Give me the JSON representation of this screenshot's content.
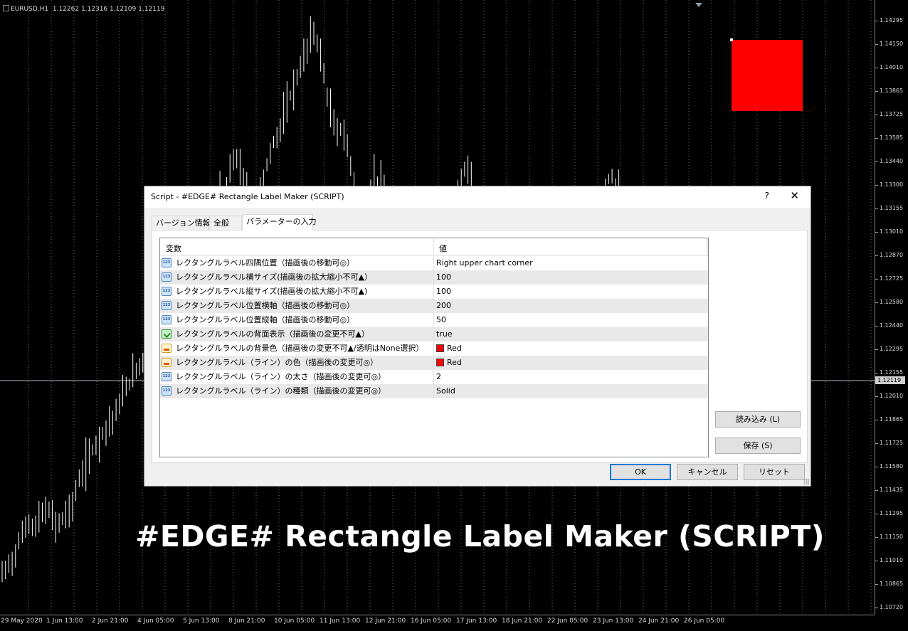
{
  "chart": {
    "symbol": "EURUSD,H1",
    "ohlc": "1.12262 1.12316 1.12109 1.12119",
    "current_price": "1.12119",
    "price_ticks": [
      "1.14295",
      "1.14150",
      "1.14010",
      "1.13865",
      "1.13725",
      "1.13585",
      "1.13440",
      "1.13300",
      "1.13155",
      "1.13010",
      "1.12870",
      "1.12725",
      "1.12580",
      "1.12440",
      "1.12295",
      "1.12155",
      "1.12010",
      "1.11865",
      "1.11725",
      "1.11580",
      "1.11435",
      "1.11295",
      "1.11150",
      "1.11010",
      "1.10865",
      "1.10720"
    ],
    "time_ticks": [
      "29 May 2020",
      "1 Jun 13:00",
      "2 Jun 21:00",
      "4 Jun 05:00",
      "5 Jun 13:00",
      "8 Jun 21:00",
      "10 Jun 05:00",
      "11 Jun 13:00",
      "12 Jun 21:00",
      "16 Jun 05:00",
      "17 Jun 13:00",
      "18 Jun 21:00",
      "22 Jun 05:00",
      "23 Jun 13:00",
      "24 Jun 21:00",
      "26 Jun 05:00"
    ],
    "price_range": [
      1.1072,
      1.1429
    ],
    "rectangle_color": "#ff0000",
    "price_series": [
      1.1094,
      1.1099,
      1.1103,
      1.1112,
      1.1121,
      1.1126,
      1.1121,
      1.1129,
      1.1133,
      1.1131,
      1.1124,
      1.1127,
      1.1131,
      1.1136,
      1.1148,
      1.1156,
      1.1164,
      1.1171,
      1.1176,
      1.1182,
      1.1186,
      1.1191,
      1.1199,
      1.1207,
      1.1212,
      1.1219,
      1.1223,
      1.1229,
      1.1236,
      1.1247,
      1.1252,
      1.1247,
      1.124,
      1.1228,
      1.1222,
      1.1236,
      1.1252,
      1.1268,
      1.1288,
      1.1312,
      1.1328,
      1.132,
      1.1332,
      1.1348,
      1.1341,
      1.1331,
      1.1322,
      1.1318,
      1.1326,
      1.1339,
      1.1352,
      1.136,
      1.1367,
      1.1379,
      1.1388,
      1.1397,
      1.1406,
      1.1418,
      1.1422,
      1.141,
      1.139,
      1.1373,
      1.136,
      1.1365,
      1.1352,
      1.1338,
      1.1321,
      1.1313,
      1.1325,
      1.1335,
      1.1331,
      1.1323,
      1.1313,
      1.13,
      1.1282,
      1.1266,
      1.125,
      1.1238,
      1.1252,
      1.1262,
      1.127,
      1.1272,
      1.1282,
      1.1301,
      1.1318,
      1.133,
      1.134,
      1.133,
      1.1312,
      1.13,
      1.1288,
      1.1278,
      1.1268,
      1.1254,
      1.124,
      1.1228,
      1.122,
      1.1212,
      1.1205,
      1.1212,
      1.122,
      1.1226,
      1.1232,
      1.1238,
      1.1244,
      1.1252,
      1.126,
      1.127,
      1.1284,
      1.1298,
      1.131,
      1.1322,
      1.133,
      1.1336,
      1.1328,
      1.1318,
      1.1305,
      1.1296,
      1.129,
      1.128,
      1.1272,
      1.1265,
      1.1258,
      1.125,
      1.1242,
      1.1236,
      1.123,
      1.1224,
      1.1218,
      1.1214,
      1.1212
    ]
  },
  "dialog": {
    "title": "Script - #EDGE# Rectangle Label Maker (SCRIPT)",
    "help": "?",
    "close": "✕",
    "tabs": [
      "バージョン情報",
      "全般",
      "パラメーターの入力"
    ],
    "header": {
      "variable": "変数",
      "value": "値"
    },
    "rows": [
      {
        "icon": "num",
        "name": "レクタングルラベル四隅位置（描画後の移動可◎）",
        "value": "Right upper chart corner"
      },
      {
        "icon": "num",
        "name": "レクタングルラベル横サイズ(描画後の拡大縮小不可▲）",
        "value": "100"
      },
      {
        "icon": "num",
        "name": "レクタングルラベル縦サイズ(描画後の拡大縮小不可▲)",
        "value": "100"
      },
      {
        "icon": "num",
        "name": "レクタングルラベル位置横軸（描画後の移動可◎）",
        "value": "200"
      },
      {
        "icon": "num",
        "name": "レクタングルラベル位置縦軸（描画後の移動可◎）",
        "value": "50"
      },
      {
        "icon": "bool",
        "name": "レクタングルラベルの背面表示（描画後の変更不可▲）",
        "value": "true"
      },
      {
        "icon": "color",
        "name": "レクタングルラベルの背景色（描画後の変更不可▲/透明はNone選択）",
        "value": "Red",
        "swatch": "#ff0000"
      },
      {
        "icon": "color",
        "name": "レクタングルラベル（ライン）の色（描画後の変更可◎）",
        "value": "Red",
        "swatch": "#ff0000"
      },
      {
        "icon": "num",
        "name": "レクタングルラベル（ライン）の太さ（描画後の変更可◎）",
        "value": "2"
      },
      {
        "icon": "num",
        "name": "レクタングルラベル（ライン）の種類（描画後の変更可◎）",
        "value": "Solid"
      }
    ],
    "load_button": "読み込み (L)",
    "save_button": "保存 (S)",
    "ok_button": "OK",
    "cancel_button": "キャンセル",
    "reset_button": "リセット"
  },
  "banner": "#EDGE# Rectangle Label Maker (SCRIPT)"
}
